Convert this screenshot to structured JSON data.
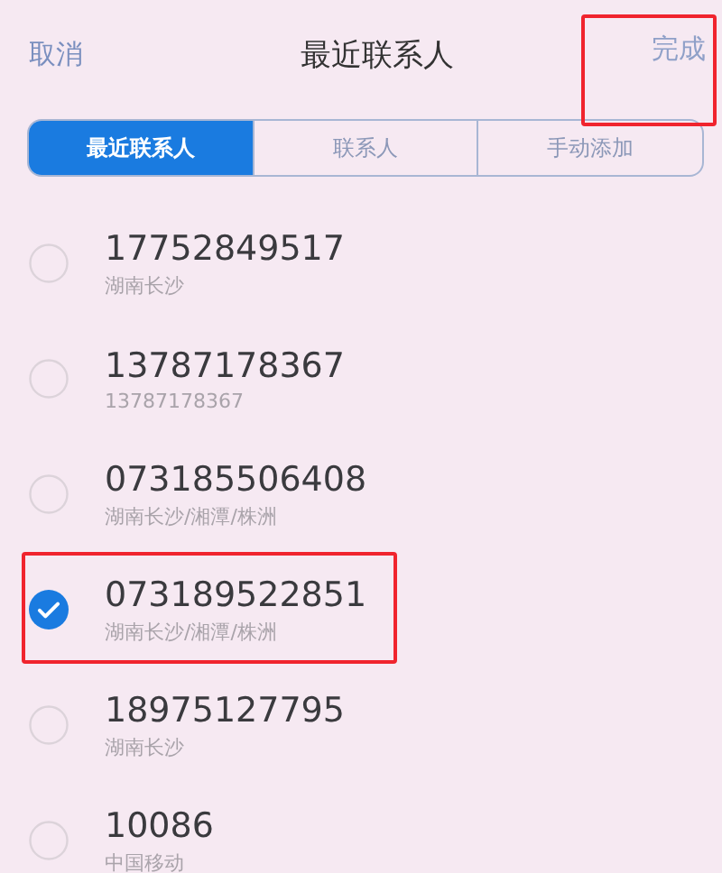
{
  "header": {
    "cancel": "取消",
    "title": "最近联系人",
    "done": {
      "label": "完成",
      "highlighted": true
    }
  },
  "tabs": [
    {
      "label": "最近联系人",
      "selected": true
    },
    {
      "label": "联系人",
      "selected": false
    },
    {
      "label": "手动添加",
      "selected": false
    }
  ],
  "contacts": [
    {
      "number": "17752849517",
      "detail": "湖南长沙",
      "checked": false,
      "highlighted": false
    },
    {
      "number": "13787178367",
      "detail": "13787178367",
      "checked": false,
      "highlighted": false
    },
    {
      "number": "073185506408",
      "detail": "湖南长沙/湘潭/株洲",
      "checked": false,
      "highlighted": false
    },
    {
      "number": "073189522851",
      "detail": "湖南长沙/湘潭/株洲",
      "checked": true,
      "highlighted": true
    },
    {
      "number": "18975127795",
      "detail": "湖南长沙",
      "checked": false,
      "highlighted": false
    },
    {
      "number": "10086",
      "detail": "中国移动",
      "checked": false,
      "highlighted": false
    }
  ]
}
